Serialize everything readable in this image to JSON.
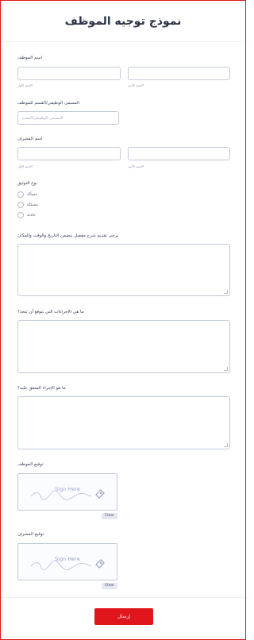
{
  "form": {
    "title": "نموذج توجيه الموظف",
    "employee_name": {
      "label": "اسم الموظف",
      "first_sub": "الاسم الأول",
      "last_sub": "الاسم الأخير"
    },
    "job_title": {
      "label": "المسمى الوظيفي/القسم للموظف",
      "placeholder": "المسمى الوظيفي/القسم"
    },
    "supervisor_name": {
      "label": "اسم المشرف",
      "first_sub": "الاسم الأول",
      "last_sub": "الاسم الأخير"
    },
    "doc_type": {
      "label": "نوع التوثيق",
      "options": [
        "مسألة",
        "مشكلة",
        "حادثة"
      ]
    },
    "description": {
      "label": "يرجى تقديم شرح مفصل يتضمن التاريخ والوقت والمكان"
    },
    "expected_actions": {
      "label": "ما هي الإجراءات التي تتوقع أن تتخذ؟"
    },
    "agreed_action": {
      "label": "ما هو الإجراء المتفق عليه؟"
    },
    "employee_signature": {
      "label": "توقيع الموظف",
      "placeholder": "Sign Here",
      "clear": "Clear"
    },
    "supervisor_signature": {
      "label": "توقيع المشرف",
      "placeholder": "Sign Here",
      "clear": "Clear"
    },
    "submit_label": "إرسال"
  },
  "colors": {
    "accent": "#e0161c",
    "border": "#c3cad8",
    "text": "#2c3345"
  }
}
